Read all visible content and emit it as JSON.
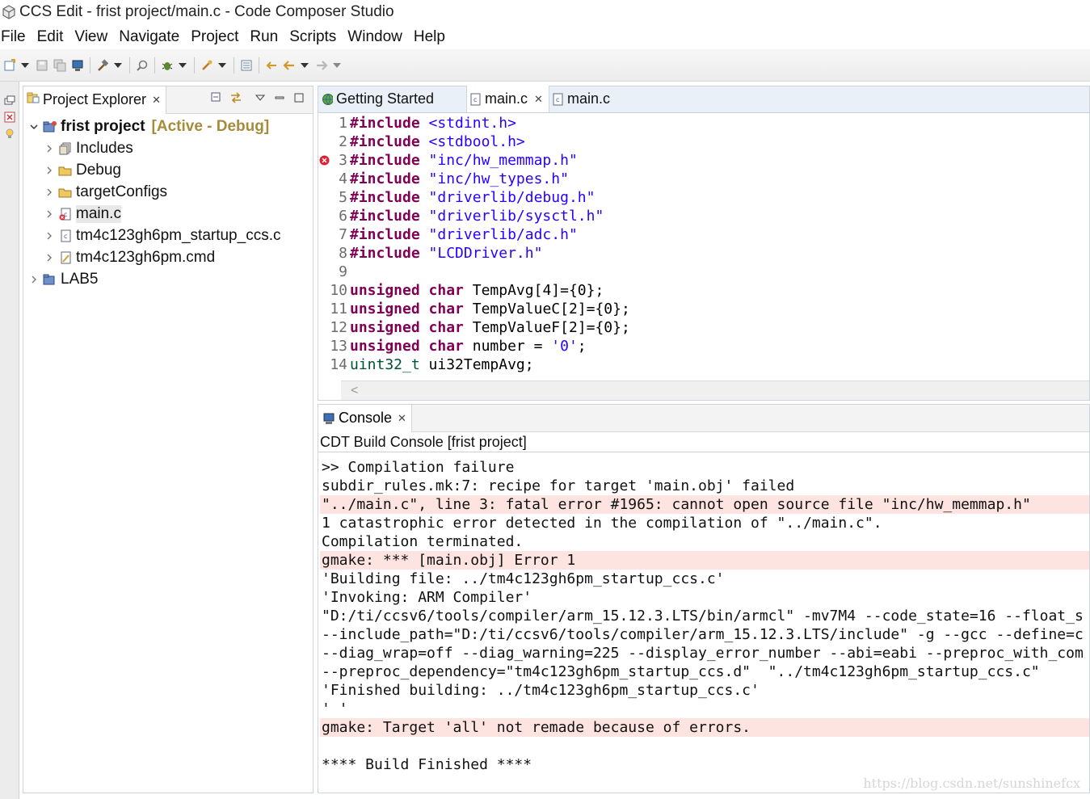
{
  "window": {
    "title": "CCS Edit - frist project/main.c - Code Composer Studio",
    "icon": "ccs-cube-icon"
  },
  "menu": [
    "File",
    "Edit",
    "View",
    "Navigate",
    "Project",
    "Run",
    "Scripts",
    "Window",
    "Help"
  ],
  "explorer": {
    "tab_label": "Project Explorer",
    "close_glyph": "✕",
    "tree": [
      {
        "label": "frist project",
        "decoration": "[Active - Debug]",
        "expanded": true,
        "icon": "project-icon"
      },
      {
        "label": "Includes",
        "icon": "includes-icon"
      },
      {
        "label": "Debug",
        "icon": "folder-icon"
      },
      {
        "label": "targetConfigs",
        "icon": "folder-icon"
      },
      {
        "label": "main.c",
        "icon": "c-file-error-icon",
        "selected": true
      },
      {
        "label": "tm4c123gh6pm_startup_ccs.c",
        "icon": "c-file-icon"
      },
      {
        "label": "tm4c123gh6pm.cmd",
        "icon": "cmd-file-icon"
      },
      {
        "label": "LAB5",
        "icon": "project-icon"
      }
    ]
  },
  "editor": {
    "tabs": [
      {
        "label": "Getting Started",
        "icon": "globe-icon",
        "active": false
      },
      {
        "label": "main.c",
        "icon": "c-file-icon",
        "active": true,
        "closable": true
      },
      {
        "label": "main.c",
        "icon": "c-file-icon",
        "active": false
      }
    ],
    "close_glyph": "✕",
    "lines": [
      {
        "n": "1",
        "parts": [
          [
            "kw",
            "#include"
          ],
          [
            "",
            " "
          ],
          [
            "str",
            "<stdint.h>"
          ]
        ]
      },
      {
        "n": "2",
        "parts": [
          [
            "kw",
            "#include"
          ],
          [
            "",
            " "
          ],
          [
            "str",
            "<stdbool.h>"
          ]
        ]
      },
      {
        "n": "3",
        "error": true,
        "parts": [
          [
            "kw",
            "#include"
          ],
          [
            "",
            " "
          ],
          [
            "str",
            "\"inc/hw_memmap.h\""
          ]
        ]
      },
      {
        "n": "4",
        "parts": [
          [
            "kw",
            "#include"
          ],
          [
            "",
            " "
          ],
          [
            "str",
            "\"inc/hw_types.h\""
          ]
        ]
      },
      {
        "n": "5",
        "parts": [
          [
            "kw",
            "#include"
          ],
          [
            "",
            " "
          ],
          [
            "str",
            "\"driverlib/debug.h\""
          ]
        ]
      },
      {
        "n": "6",
        "parts": [
          [
            "kw",
            "#include"
          ],
          [
            "",
            " "
          ],
          [
            "str",
            "\"driverlib/sysctl.h\""
          ]
        ]
      },
      {
        "n": "7",
        "parts": [
          [
            "kw",
            "#include"
          ],
          [
            "",
            " "
          ],
          [
            "str",
            "\"driverlib/adc.h\""
          ]
        ]
      },
      {
        "n": "8",
        "parts": [
          [
            "kw",
            "#include"
          ],
          [
            "",
            " "
          ],
          [
            "str",
            "\"LCDDriver.h\""
          ]
        ]
      },
      {
        "n": "9",
        "parts": []
      },
      {
        "n": "10",
        "parts": [
          [
            "kw",
            "unsigned"
          ],
          [
            "",
            " "
          ],
          [
            "kw",
            "char"
          ],
          [
            "",
            " TempAvg[4]={0};"
          ]
        ]
      },
      {
        "n": "11",
        "parts": [
          [
            "kw",
            "unsigned"
          ],
          [
            "",
            " "
          ],
          [
            "kw",
            "char"
          ],
          [
            "",
            " TempValueC[2]={0};"
          ]
        ]
      },
      {
        "n": "12",
        "parts": [
          [
            "kw",
            "unsigned"
          ],
          [
            "",
            " "
          ],
          [
            "kw",
            "char"
          ],
          [
            "",
            " TempValueF[2]={0};"
          ]
        ]
      },
      {
        "n": "13",
        "parts": [
          [
            "kw",
            "unsigned"
          ],
          [
            "",
            " "
          ],
          [
            "kw",
            "char"
          ],
          [
            "",
            " number = "
          ],
          [
            "str",
            "'0'"
          ],
          [
            "",
            ";"
          ]
        ]
      },
      {
        "n": "14",
        "parts": [
          [
            "typ",
            "uint32_t"
          ],
          [
            "",
            " ui32TempAvg;"
          ]
        ]
      }
    ],
    "hscroll_arrow": "<"
  },
  "console": {
    "tab_label": "Console",
    "close_glyph": "✕",
    "title": "CDT Build Console [frist project]",
    "lines": [
      {
        "text": ">> Compilation failure",
        "err": false
      },
      {
        "text": "subdir_rules.mk:7: recipe for target 'main.obj' failed",
        "err": false
      },
      {
        "text": "\"../main.c\", line 3: fatal error #1965: cannot open source file \"inc/hw_memmap.h\"",
        "err": true
      },
      {
        "text": "1 catastrophic error detected in the compilation of \"../main.c\".",
        "err": false
      },
      {
        "text": "Compilation terminated.",
        "err": false
      },
      {
        "text": "gmake: *** [main.obj] Error 1",
        "err": true
      },
      {
        "text": "'Building file: ../tm4c123gh6pm_startup_ccs.c'",
        "err": false
      },
      {
        "text": "'Invoking: ARM Compiler'",
        "err": false
      },
      {
        "text": "\"D:/ti/ccsv6/tools/compiler/arm_15.12.3.LTS/bin/armcl\" -mv7M4 --code_state=16 --float_s",
        "err": false
      },
      {
        "text": "--include_path=\"D:/ti/ccsv6/tools/compiler/arm_15.12.3.LTS/include\" -g --gcc --define=c",
        "err": false
      },
      {
        "text": "--diag_wrap=off --diag_warning=225 --display_error_number --abi=eabi --preproc_with_com",
        "err": false
      },
      {
        "text": "--preproc_dependency=\"tm4c123gh6pm_startup_ccs.d\"  \"../tm4c123gh6pm_startup_ccs.c\"",
        "err": false
      },
      {
        "text": "'Finished building: ../tm4c123gh6pm_startup_ccs.c'",
        "err": false
      },
      {
        "text": "' '",
        "err": false
      },
      {
        "text": "gmake: Target 'all' not remade because of errors.",
        "err": true
      },
      {
        "text": "",
        "err": false
      },
      {
        "text": "**** Build Finished ****",
        "err": false
      }
    ]
  },
  "watermark": "https://blog.csdn.net/sunshinefcx"
}
